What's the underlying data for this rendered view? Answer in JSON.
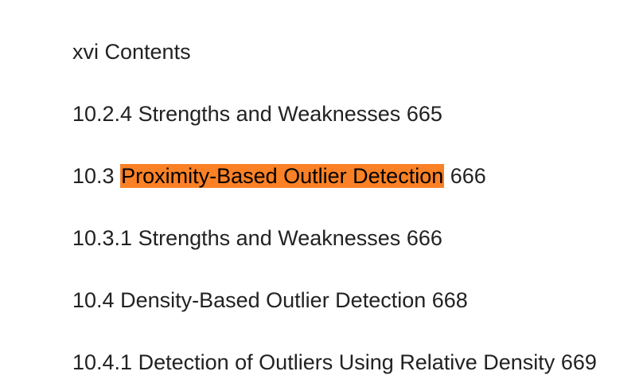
{
  "top_partial": "",
  "header": "xvi Contents",
  "entries": [
    {
      "number": "10.2.4",
      "title": "Strengths and Weaknesses",
      "page": "665"
    },
    {
      "number": "10.3",
      "title": "Proximity-Based Outlier Detection",
      "page": "666",
      "highlight_color": "#fa8125"
    },
    {
      "number": "10.3.1",
      "title": "Strengths and Weaknesses",
      "page": "666"
    },
    {
      "number": "10.4",
      "title": "Density-Based Outlier Detection",
      "page": "668"
    },
    {
      "number": "10.4.1",
      "title": "Detection of Outliers Using Relative Density",
      "page": "669"
    }
  ]
}
